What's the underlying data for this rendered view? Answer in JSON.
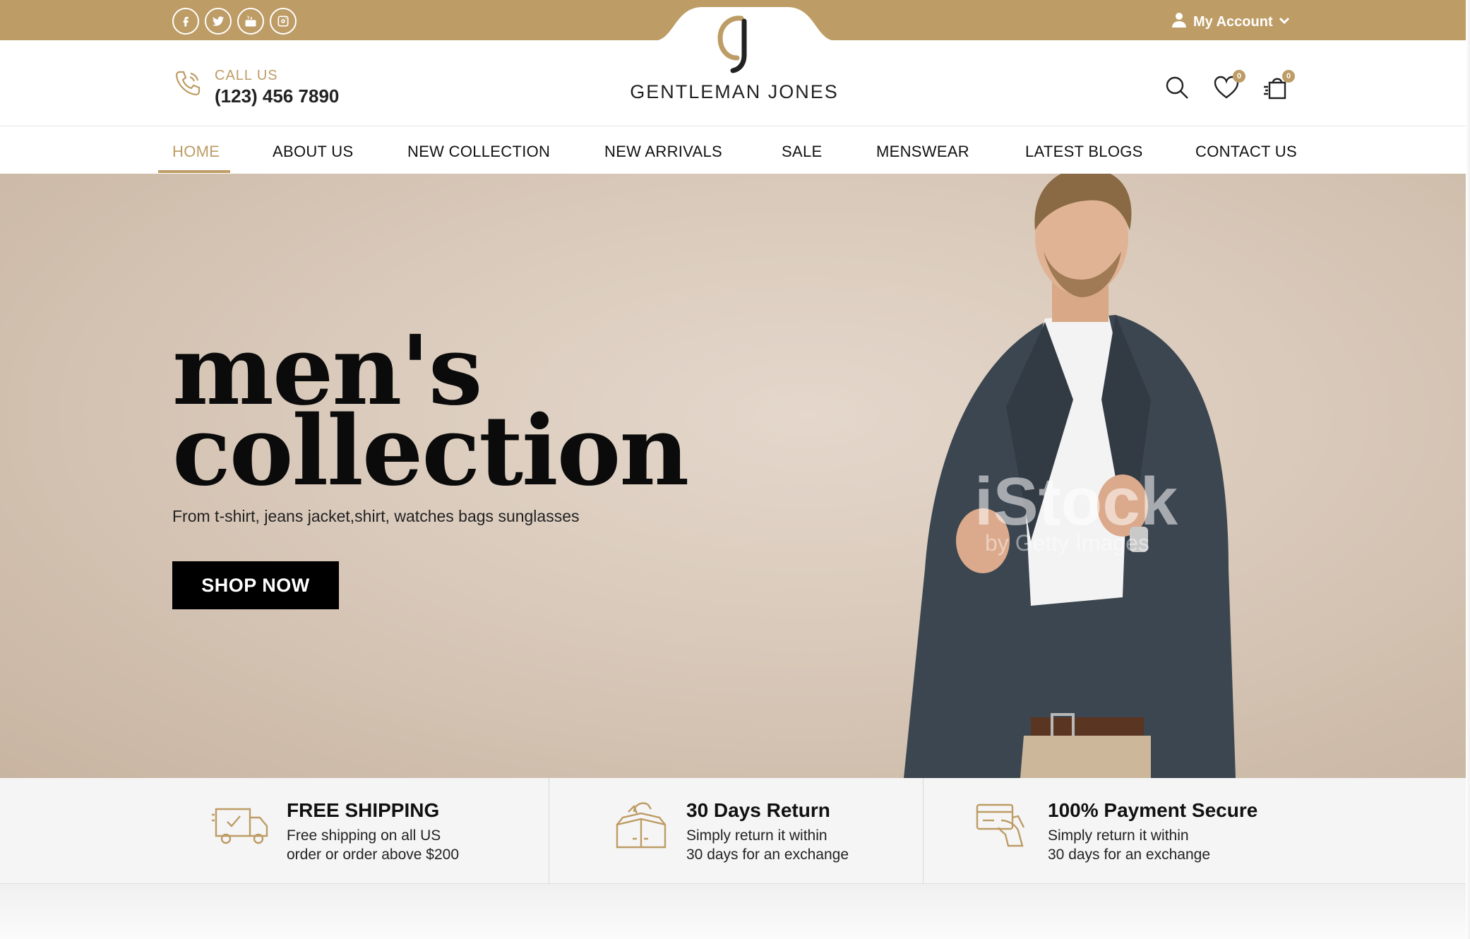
{
  "topbar": {
    "social": [
      "facebook",
      "twitter",
      "youtube",
      "instagram"
    ],
    "account_label": "My Account"
  },
  "brand": {
    "monogram": "GJ",
    "name": "GENTLEMAN JONES",
    "color": "#bd9c65"
  },
  "header": {
    "call_label": "CALL US",
    "call_number": "(123) 456 7890",
    "wishlist_count": "0",
    "cart_count": "0"
  },
  "nav": {
    "items": [
      {
        "label": "HOME",
        "active": true
      },
      {
        "label": "ABOUT US"
      },
      {
        "label": "NEW COLLECTION"
      },
      {
        "label": "NEW ARRIVALS"
      },
      {
        "label": "SALE"
      },
      {
        "label": "MENSWEAR"
      },
      {
        "label": "LATEST BLOGS"
      },
      {
        "label": "CONTACT US"
      }
    ]
  },
  "hero": {
    "title_line1": "men's",
    "title_line2": "collection",
    "subtitle": "From t-shirt, jeans jacket,shirt, watches bags sunglasses",
    "cta": "SHOP NOW",
    "watermark": "iStock",
    "watermark_sub": "by Getty Images"
  },
  "features": [
    {
      "icon": "truck-icon",
      "title": "FREE SHIPPING",
      "line1": "Free shipping on all US",
      "line2": "order or order above $200"
    },
    {
      "icon": "return-box-icon",
      "title": "30 Days Return",
      "line1": "Simply return it within",
      "line2": "30 days for an exchange"
    },
    {
      "icon": "card-payment-icon",
      "title": "100% Payment Secure",
      "line1": "Simply return it within",
      "line2": "30 days for an exchange"
    }
  ]
}
